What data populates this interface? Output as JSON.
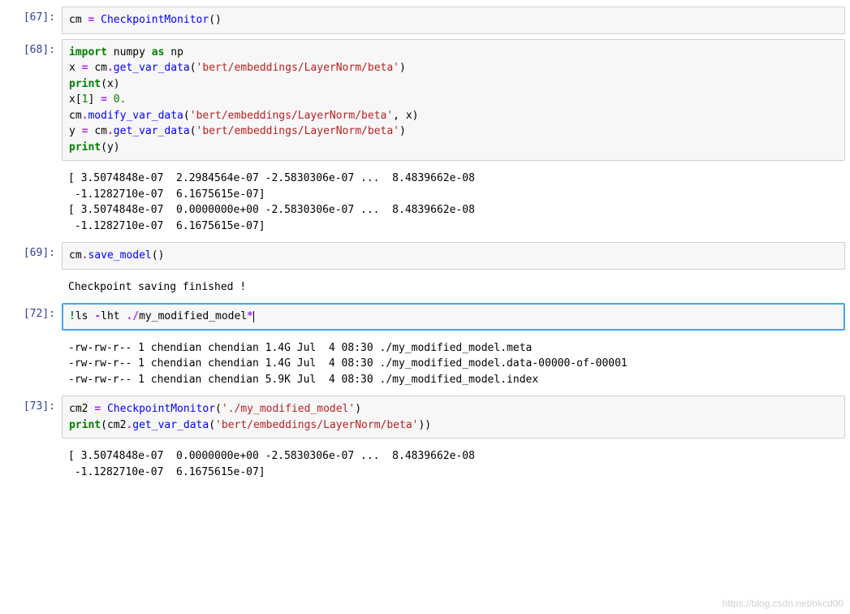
{
  "cells": [
    {
      "prompt": "[67]:",
      "code_tokens": [
        [
          "name",
          "cm"
        ],
        [
          "plain",
          " "
        ],
        [
          "op",
          "="
        ],
        [
          "plain",
          " "
        ],
        [
          "call",
          "CheckpointMonitor"
        ],
        [
          "paren",
          "()"
        ]
      ],
      "output": ""
    },
    {
      "prompt": "[68]:",
      "code_tokens": [
        [
          "kw",
          "import"
        ],
        [
          "plain",
          " "
        ],
        [
          "name",
          "numpy"
        ],
        [
          "plain",
          " "
        ],
        [
          "kw",
          "as"
        ],
        [
          "plain",
          " "
        ],
        [
          "name",
          "np"
        ],
        [
          "nl",
          ""
        ],
        [
          "name",
          "x"
        ],
        [
          "plain",
          " "
        ],
        [
          "op",
          "="
        ],
        [
          "plain",
          " "
        ],
        [
          "name",
          "cm"
        ],
        [
          "op",
          "."
        ],
        [
          "call",
          "get_var_data"
        ],
        [
          "paren",
          "("
        ],
        [
          "str",
          "'bert/embeddings/LayerNorm/beta'"
        ],
        [
          "paren",
          ")"
        ],
        [
          "nl",
          ""
        ],
        [
          "builtin",
          "print"
        ],
        [
          "paren",
          "("
        ],
        [
          "name",
          "x"
        ],
        [
          "paren",
          ")"
        ],
        [
          "nl",
          ""
        ],
        [
          "name",
          "x"
        ],
        [
          "paren",
          "["
        ],
        [
          "num",
          "1"
        ],
        [
          "paren",
          "]"
        ],
        [
          "plain",
          " "
        ],
        [
          "op",
          "="
        ],
        [
          "plain",
          " "
        ],
        [
          "num",
          "0."
        ],
        [
          "nl",
          ""
        ],
        [
          "name",
          "cm"
        ],
        [
          "op",
          "."
        ],
        [
          "call",
          "modify_var_data"
        ],
        [
          "paren",
          "("
        ],
        [
          "str",
          "'bert/embeddings/LayerNorm/beta'"
        ],
        [
          "paren",
          ","
        ],
        [
          "plain",
          " "
        ],
        [
          "name",
          "x"
        ],
        [
          "paren",
          ")"
        ],
        [
          "nl",
          ""
        ],
        [
          "name",
          "y"
        ],
        [
          "plain",
          " "
        ],
        [
          "op",
          "="
        ],
        [
          "plain",
          " "
        ],
        [
          "name",
          "cm"
        ],
        [
          "op",
          "."
        ],
        [
          "call",
          "get_var_data"
        ],
        [
          "paren",
          "("
        ],
        [
          "str",
          "'bert/embeddings/LayerNorm/beta'"
        ],
        [
          "paren",
          ")"
        ],
        [
          "nl",
          ""
        ],
        [
          "builtin",
          "print"
        ],
        [
          "paren",
          "("
        ],
        [
          "name",
          "y"
        ],
        [
          "paren",
          ")"
        ]
      ],
      "output": "[ 3.5074848e-07  2.2984564e-07 -2.5830306e-07 ...  8.4839662e-08\n -1.1282710e-07  6.1675615e-07]\n[ 3.5074848e-07  0.0000000e+00 -2.5830306e-07 ...  8.4839662e-08\n -1.1282710e-07  6.1675615e-07]"
    },
    {
      "prompt": "[69]:",
      "code_tokens": [
        [
          "name",
          "cm"
        ],
        [
          "op",
          "."
        ],
        [
          "call",
          "save_model"
        ],
        [
          "paren",
          "()"
        ]
      ],
      "output": "Checkpoint saving finished !"
    },
    {
      "prompt": "[72]:",
      "selected": true,
      "code_tokens": [
        [
          "magic",
          "!"
        ],
        [
          "name",
          "ls"
        ],
        [
          "plain",
          " "
        ],
        [
          "op",
          "-"
        ],
        [
          "name",
          "lht"
        ],
        [
          "plain",
          " "
        ],
        [
          "op",
          "."
        ],
        [
          "op",
          "/"
        ],
        [
          "name",
          "my_modified_model"
        ],
        [
          "op",
          "*"
        ]
      ],
      "cursor": true,
      "output": "-rw-rw-r-- 1 chendian chendian 1.4G Jul  4 08:30 ./my_modified_model.meta\n-rw-rw-r-- 1 chendian chendian 1.4G Jul  4 08:30 ./my_modified_model.data-00000-of-00001\n-rw-rw-r-- 1 chendian chendian 5.9K Jul  4 08:30 ./my_modified_model.index"
    },
    {
      "prompt": "[73]:",
      "code_tokens": [
        [
          "name",
          "cm2"
        ],
        [
          "plain",
          " "
        ],
        [
          "op",
          "="
        ],
        [
          "plain",
          " "
        ],
        [
          "call",
          "CheckpointMonitor"
        ],
        [
          "paren",
          "("
        ],
        [
          "str",
          "'./my_modified_model'"
        ],
        [
          "paren",
          ")"
        ],
        [
          "nl",
          ""
        ],
        [
          "builtin",
          "print"
        ],
        [
          "paren",
          "("
        ],
        [
          "name",
          "cm2"
        ],
        [
          "op",
          "."
        ],
        [
          "call",
          "get_var_data"
        ],
        [
          "paren",
          "("
        ],
        [
          "str",
          "'bert/embeddings/LayerNorm/beta'"
        ],
        [
          "paren",
          "))"
        ]
      ],
      "output": "[ 3.5074848e-07  0.0000000e+00 -2.5830306e-07 ...  8.4839662e-08\n -1.1282710e-07  6.1675615e-07]"
    }
  ],
  "watermark": "https://blog.csdn.net/okcd00"
}
